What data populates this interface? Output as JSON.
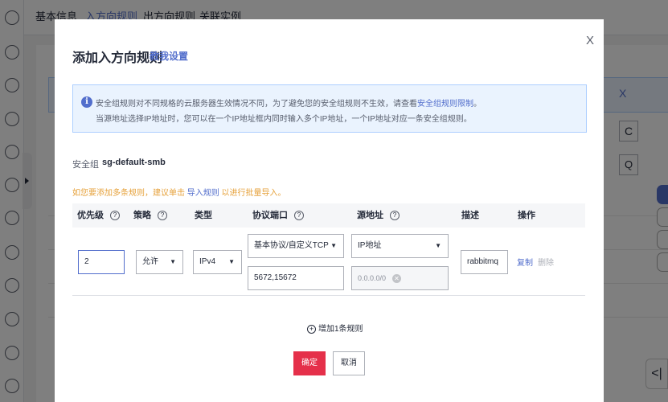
{
  "background": {
    "tabs": [
      "基本信息",
      "入方向规则",
      "出方向规则",
      "关联实例"
    ],
    "info_close": "X",
    "refresh_icon": "C",
    "search_icon": "Q",
    "collapse_icon": "<|"
  },
  "modal": {
    "title": "添加入方向规则",
    "title_link": "教我设置",
    "close": "X",
    "notice": {
      "line1_prefix": "安全组规则对不同规格的云服务器生效情况不同，为了避免您的安全组规则不生效，请查看",
      "line1_link": "安全组规则限制",
      "line1_suffix": "。",
      "line2": "当源地址选择IP地址时，您可以在一个IP地址框内同时输入多个IP地址，一个IP地址对应一条安全组规则。"
    },
    "security_group": {
      "label": "安全组",
      "value": "sg-default-smb"
    },
    "hint": {
      "prefix": "如您要添加多条规则，建议单击 ",
      "link": "导入规则",
      "suffix": " 以进行批量导入。"
    },
    "table": {
      "headers": {
        "priority": "优先级",
        "policy": "策略",
        "type": "类型",
        "protocol_port": "协议端口",
        "source": "源地址",
        "description": "描述",
        "actions": "操作"
      },
      "row": {
        "priority": "2",
        "policy": "允许",
        "type": "IPv4",
        "protocol": "基本协议/自定义TCP",
        "ports": "5672,15672",
        "source_type": "IP地址",
        "source_tag": "0.0.0.0/0",
        "description": "rabbitmq",
        "copy": "复制",
        "delete": "删除"
      }
    },
    "add_rule": "增加1条规则",
    "confirm": "确定",
    "cancel": "取消"
  }
}
